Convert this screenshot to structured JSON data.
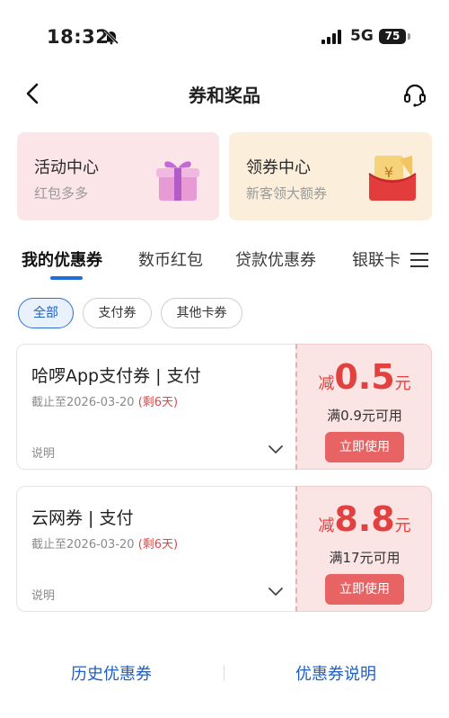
{
  "status_bar": {
    "time": "18:32",
    "network": "5G",
    "battery": "75"
  },
  "nav": {
    "title": "券和奖品"
  },
  "promos": [
    {
      "title": "活动中心",
      "subtitle": "红包多多",
      "icon": "gift-icon"
    },
    {
      "title": "领券中心",
      "subtitle": "新客领大额券",
      "icon": "red-envelope-icon"
    }
  ],
  "tabs": [
    "我的优惠券",
    "数币红包",
    "贷款优惠券",
    "银联卡"
  ],
  "filters": [
    "全部",
    "支付券",
    "其他卡券"
  ],
  "coupons": [
    {
      "name": "哈啰App支付券 | 支付",
      "expiry": "截止至2026-03-20",
      "remaining": "(剩6天)",
      "desc": "说明",
      "prefix": "减",
      "amount": "0.5",
      "unit": "元",
      "condition": "满0.9元可用",
      "button": "立即使用"
    },
    {
      "name": "云网券 | 支付",
      "expiry": "截止至2026-03-20",
      "remaining": "(剩6天)",
      "desc": "说明",
      "prefix": "减",
      "amount": "8.8",
      "unit": "元",
      "condition": "满17元可用",
      "button": "立即使用"
    }
  ],
  "footer": {
    "history": "历史优惠券",
    "explain": "优惠券说明"
  },
  "colors": {
    "accent": "#1e6fd9",
    "coupon_red": "#e1413f",
    "button_red": "#e86363"
  }
}
